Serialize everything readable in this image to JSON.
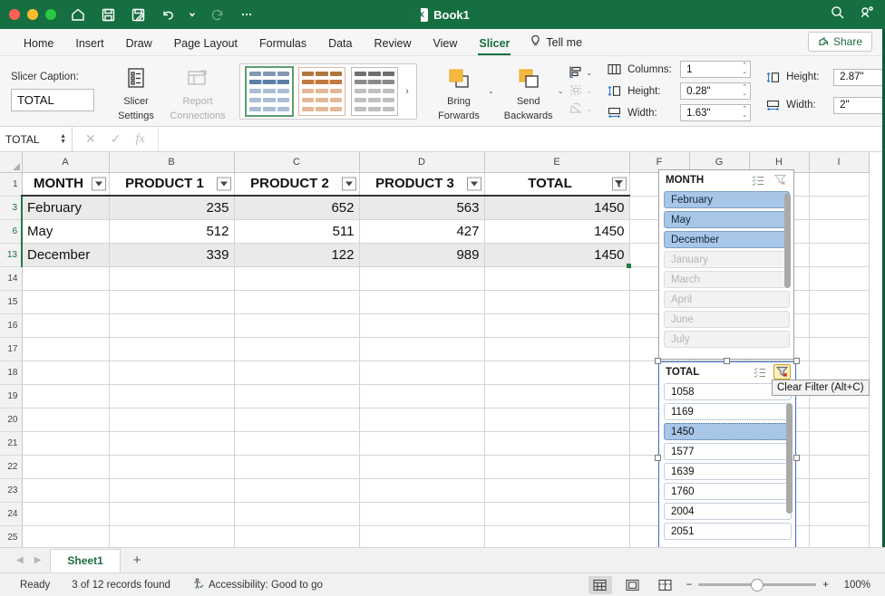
{
  "titlebar": {
    "filename": "Book1",
    "quick_access": [
      "home-icon",
      "save-icon",
      "save-as-icon",
      "undo-icon",
      "undo-dropdown-icon",
      "redo-icon",
      "more-icon"
    ],
    "right_icons": [
      "search-icon",
      "settings-icon"
    ]
  },
  "tabs": [
    {
      "label": "Home",
      "active": false
    },
    {
      "label": "Insert",
      "active": false
    },
    {
      "label": "Draw",
      "active": false
    },
    {
      "label": "Page Layout",
      "active": false
    },
    {
      "label": "Formulas",
      "active": false
    },
    {
      "label": "Data",
      "active": false
    },
    {
      "label": "Review",
      "active": false
    },
    {
      "label": "View",
      "active": false
    },
    {
      "label": "Slicer",
      "active": true
    }
  ],
  "tell_me": "Tell me",
  "share_label": "Share",
  "ribbon": {
    "caption_label": "Slicer Caption:",
    "caption_value": "TOTAL",
    "slicer_settings": "Slicer\nSettings",
    "slicer_settings_l1": "Slicer",
    "slicer_settings_l2": "Settings",
    "report_connections_l1": "Report",
    "report_connections_l2": "Connections",
    "bring_forwards_l1": "Bring",
    "bring_forwards_l2": "Forwards",
    "send_backwards_l1": "Send",
    "send_backwards_l2": "Backwards",
    "buttons_group": [
      {
        "label": "Columns:",
        "value": "1",
        "icon": "columns-icon"
      },
      {
        "label": "Height:",
        "value": "0.28\"",
        "icon": "height-icon"
      },
      {
        "label": "Width:",
        "value": "1.63\"",
        "icon": "width-icon"
      }
    ],
    "size_group": [
      {
        "label": "Height:",
        "value": "2.87\"",
        "icon": "height-icon"
      },
      {
        "label": "Width:",
        "value": "2\"",
        "icon": "width-icon"
      }
    ]
  },
  "formula_bar": {
    "name_box": "TOTAL",
    "cancel_icon": "cancel-icon",
    "confirm_icon": "confirm-icon",
    "fx_icon": "fx",
    "formula_value": ""
  },
  "grid": {
    "column_headers": [
      "A",
      "B",
      "C",
      "D",
      "E",
      "F",
      "G",
      "H",
      "I"
    ],
    "row_numbers": [
      "1",
      "3",
      "6",
      "13",
      "14",
      "15",
      "16",
      "17",
      "18",
      "19",
      "20",
      "21",
      "22",
      "23",
      "24",
      "25"
    ],
    "table_headers": [
      "MONTH",
      "PRODUCT 1",
      "PRODUCT 2",
      "PRODUCT 3",
      "TOTAL"
    ],
    "rows": [
      {
        "row": "3",
        "cells": [
          "February",
          "235",
          "652",
          "563",
          "1450"
        ]
      },
      {
        "row": "6",
        "cells": [
          "May",
          "512",
          "511",
          "427",
          "1450"
        ]
      },
      {
        "row": "13",
        "cells": [
          "December",
          "339",
          "122",
          "989",
          "1450"
        ]
      }
    ]
  },
  "slicer_month": {
    "title": "MONTH",
    "multiselect_icon": "multi-select-icon",
    "clear_icon": "clear-filter-icon",
    "items": [
      {
        "label": "February",
        "state": "selected"
      },
      {
        "label": "May",
        "state": "selected"
      },
      {
        "label": "December",
        "state": "selected"
      },
      {
        "label": "January",
        "state": "unavailable"
      },
      {
        "label": "March",
        "state": "unavailable"
      },
      {
        "label": "April",
        "state": "unavailable"
      },
      {
        "label": "June",
        "state": "unavailable"
      },
      {
        "label": "July",
        "state": "unavailable"
      }
    ]
  },
  "slicer_total": {
    "title": "TOTAL",
    "multiselect_icon": "multi-select-icon",
    "clear_icon": "clear-filter-icon",
    "tooltip": "Clear Filter (Alt+C)",
    "items": [
      {
        "label": "1058",
        "state": "normal"
      },
      {
        "label": "1169",
        "state": "normal"
      },
      {
        "label": "1450",
        "state": "current"
      },
      {
        "label": "1577",
        "state": "normal"
      },
      {
        "label": "1639",
        "state": "normal"
      },
      {
        "label": "1760",
        "state": "normal"
      },
      {
        "label": "2004",
        "state": "normal"
      },
      {
        "label": "2051",
        "state": "normal"
      }
    ]
  },
  "sheet_tabs": {
    "prev_icon": "prev-sheet-icon",
    "next_icon": "next-sheet-icon",
    "tabs": [
      "Sheet1"
    ],
    "add_label": "+"
  },
  "status_bar": {
    "mode": "Ready",
    "records": "3 of 12 records found",
    "accessibility": "Accessibility: Good to go",
    "views": [
      "normal-view-icon",
      "page-layout-icon",
      "page-break-icon"
    ],
    "zoom_out": "−",
    "zoom_in": "+",
    "zoom_level": "100%"
  },
  "colors": {
    "brand_green": "#156f40",
    "slicer_selected": "#a8c6e8",
    "highlight_yellow": "#fdf0c0"
  }
}
